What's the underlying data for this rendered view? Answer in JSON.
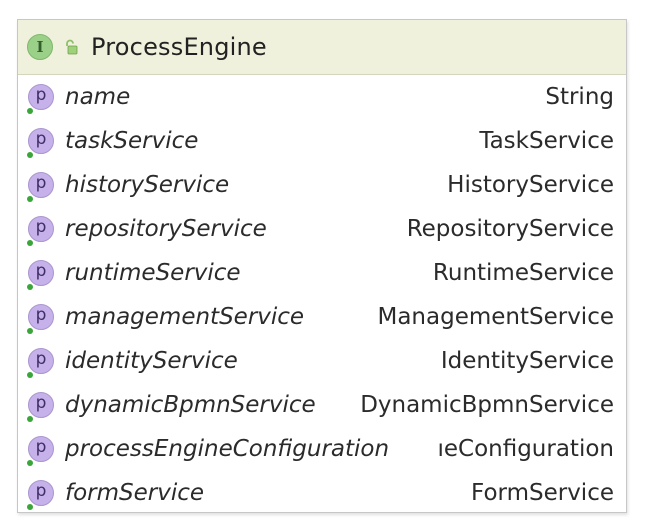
{
  "class": {
    "badge": "I",
    "title": "ProcessEngine",
    "icons": [
      "interface-icon",
      "lock-icon"
    ]
  },
  "property_badge": "p",
  "properties": [
    {
      "name": "name",
      "type": "String"
    },
    {
      "name": "taskService",
      "type": "TaskService"
    },
    {
      "name": "historyService",
      "type": "HistoryService"
    },
    {
      "name": "repositoryService",
      "type": "RepositoryService"
    },
    {
      "name": "runtimeService",
      "type": "RuntimeService"
    },
    {
      "name": "managementService",
      "type": "ManagementService"
    },
    {
      "name": "identityService",
      "type": "IdentityService"
    },
    {
      "name": "dynamicBpmnService",
      "type": "DynamicBpmnService"
    },
    {
      "name": "processEngineConfiguration",
      "type": "ıeConfiguration"
    },
    {
      "name": "formService",
      "type": "FormService"
    }
  ],
  "colors": {
    "header_bg": "#f0f1dc",
    "interface_badge": "#9bd089",
    "property_badge": "#c6b1ea",
    "visibility_dot": "#3aa63a"
  }
}
